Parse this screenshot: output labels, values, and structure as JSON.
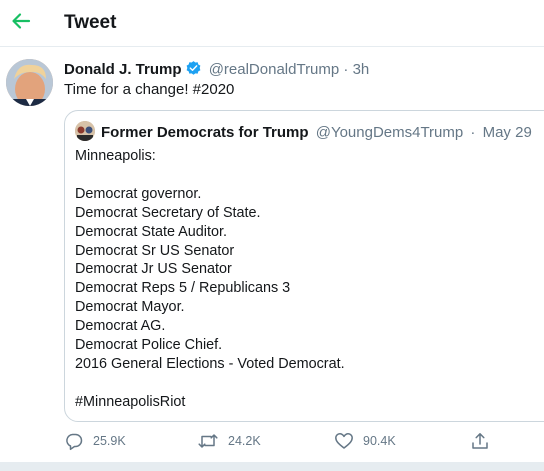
{
  "header": {
    "title": "Tweet",
    "back_icon": "arrow-left-icon",
    "accent": "#17bf63"
  },
  "tweet": {
    "author_name": "Donald J. Trump",
    "verified_icon": "verified-badge-icon",
    "handle": "@realDonaldTrump",
    "separator": "·",
    "time": "3h",
    "text": "Time for a change! #2020",
    "link_color": "#1da1f2"
  },
  "quote": {
    "author_name": "Former Democrats for Trump",
    "handle": "@YoungDems4Trump",
    "separator": "·",
    "date": "May 29",
    "text": "Minneapolis:\n\nDemocrat governor.\nDemocrat Secretary of State.\nDemocrat State Auditor.\nDemocrat Sr US Senator\nDemocrat Jr US Senator\nDemocrat Reps 5 / Republicans 3\nDemocrat Mayor.\nDemocrat AG.\nDemocrat Police Chief.\n2016 General Elections - Voted Democrat.\n\n#MinneapolisRiot"
  },
  "actions": {
    "reply": {
      "icon": "reply-icon",
      "count": "25.9K"
    },
    "retweet": {
      "icon": "retweet-icon",
      "count": "24.2K"
    },
    "like": {
      "icon": "heart-icon",
      "count": "90.4K"
    },
    "share": {
      "icon": "share-icon"
    }
  }
}
